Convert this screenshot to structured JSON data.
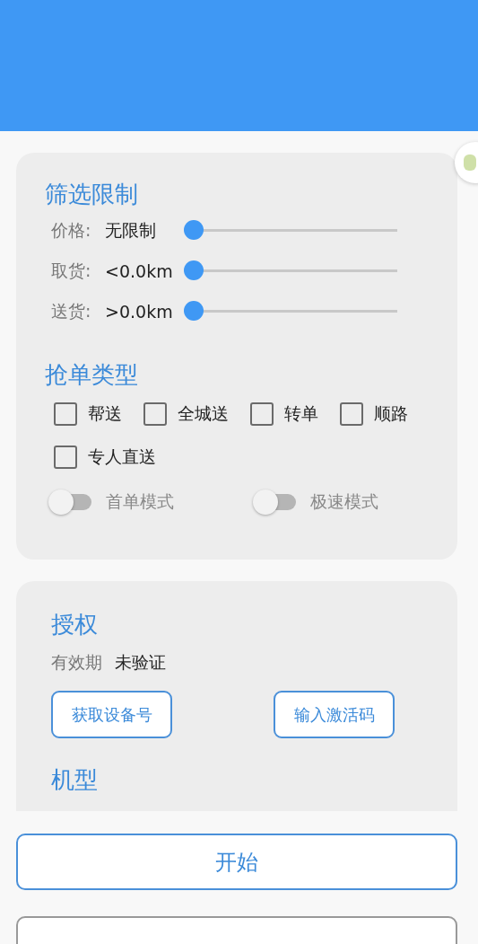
{
  "filter": {
    "title": "筛选限制",
    "sliders": [
      {
        "label": "价格:",
        "value": "无限制",
        "level": 0
      },
      {
        "label": "取货:",
        "value": "<0.0km",
        "level": 0
      },
      {
        "label": "送货:",
        "value": ">0.0km",
        "level": 0
      }
    ]
  },
  "order_types": {
    "title": "抢单类型",
    "options": [
      {
        "label": "帮送",
        "checked": false
      },
      {
        "label": "全城送",
        "checked": false
      },
      {
        "label": "转单",
        "checked": false
      },
      {
        "label": "顺路",
        "checked": false
      },
      {
        "label": "专人直送",
        "checked": false
      }
    ],
    "switches": [
      {
        "label": "首单模式",
        "on": false
      },
      {
        "label": "极速模式",
        "on": false
      }
    ]
  },
  "authorization": {
    "title": "授权",
    "validity_label": "有效期",
    "validity_value": "未验证",
    "buttons": [
      "获取设备号",
      "输入激活码"
    ]
  },
  "model": {
    "title": "机型"
  },
  "start_button": "开始"
}
